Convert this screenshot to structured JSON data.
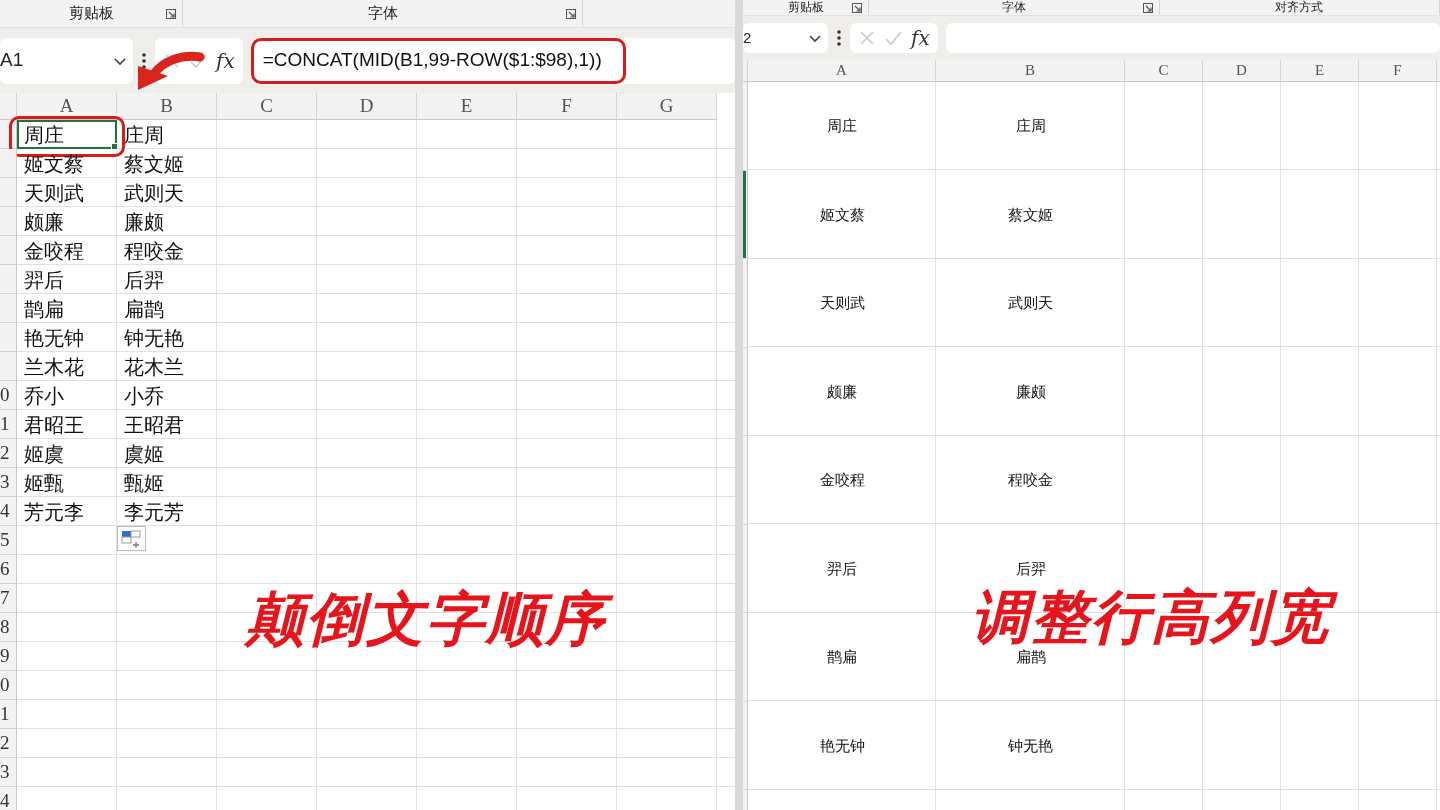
{
  "panels": [
    {
      "ribbon_groups": [
        {
          "label": "剪贴板",
          "launcher": true
        },
        {
          "label": "字体",
          "launcher": true
        }
      ],
      "name_box": "A1",
      "function_label": "fx",
      "formula": {
        "text": "=CONCAT(MID(B1,99-ROW($1:$98),1))",
        "highlighted": true
      },
      "arrow": true,
      "columns": [
        "A",
        "B",
        "C",
        "D",
        "E",
        "F",
        "G"
      ],
      "rows": [
        {
          "cells": [
            {
              "text": "周庄",
              "selected": true,
              "highlighted": true
            },
            {
              "text": "庄周",
              "selected": false,
              "highlighted": false
            }
          ]
        },
        {
          "cells": [
            {
              "text": "姬文蔡",
              "selected": false,
              "highlighted": false
            },
            {
              "text": "蔡文姬",
              "selected": false,
              "highlighted": false
            }
          ]
        },
        {
          "cells": [
            {
              "text": "天则武",
              "selected": false,
              "highlighted": false
            },
            {
              "text": "武则天",
              "selected": false,
              "highlighted": false
            }
          ]
        },
        {
          "cells": [
            {
              "text": "颇廉",
              "selected": false,
              "highlighted": false
            },
            {
              "text": "廉颇",
              "selected": false,
              "highlighted": false
            }
          ]
        },
        {
          "cells": [
            {
              "text": "金咬程",
              "selected": false,
              "highlighted": false
            },
            {
              "text": "程咬金",
              "selected": false,
              "highlighted": false
            }
          ]
        },
        {
          "cells": [
            {
              "text": "羿后",
              "selected": false,
              "highlighted": false
            },
            {
              "text": "后羿",
              "selected": false,
              "highlighted": false
            }
          ]
        },
        {
          "cells": [
            {
              "text": "鹊扁",
              "selected": false,
              "highlighted": false
            },
            {
              "text": "扁鹊",
              "selected": false,
              "highlighted": false
            }
          ]
        },
        {
          "cells": [
            {
              "text": "艳无钟",
              "selected": false,
              "highlighted": false
            },
            {
              "text": "钟无艳",
              "selected": false,
              "highlighted": false
            }
          ]
        },
        {
          "cells": [
            {
              "text": "兰木花",
              "selected": false,
              "highlighted": false
            },
            {
              "text": "花木兰",
              "selected": false,
              "highlighted": false
            }
          ]
        },
        {
          "header": "0",
          "cells": [
            {
              "text": "乔小",
              "selected": false,
              "highlighted": false
            },
            {
              "text": "小乔",
              "selected": false,
              "highlighted": false
            }
          ]
        },
        {
          "header": "1",
          "cells": [
            {
              "text": "君昭王",
              "selected": false,
              "highlighted": false
            },
            {
              "text": "王昭君",
              "selected": false,
              "highlighted": false
            }
          ]
        },
        {
          "header": "2",
          "cells": [
            {
              "text": "姬虞",
              "selected": false,
              "highlighted": false
            },
            {
              "text": "虞姬",
              "selected": false,
              "highlighted": false
            }
          ]
        },
        {
          "header": "3",
          "cells": [
            {
              "text": "姬甄",
              "selected": false,
              "highlighted": false
            },
            {
              "text": "甄姬",
              "selected": false,
              "highlighted": false
            }
          ]
        },
        {
          "header": "4",
          "cells": [
            {
              "text": "芳元李",
              "selected": false,
              "highlighted": false
            },
            {
              "text": "李元芳",
              "selected": false,
              "highlighted": false
            }
          ]
        },
        {
          "header": "5"
        },
        {
          "header": "6"
        },
        {
          "header": "7"
        },
        {
          "header": "8"
        },
        {
          "header": "9"
        },
        {
          "header": "0"
        },
        {
          "header": "1"
        },
        {
          "header": "2"
        },
        {
          "header": "3"
        },
        {
          "header": "4"
        }
      ],
      "caption": "颠倒文字顺序"
    },
    {
      "ribbon_groups": [
        {
          "label": "剪贴板",
          "launcher": true
        },
        {
          "label": "字体",
          "launcher": true
        },
        {
          "label": "对齐方式",
          "launcher": false
        }
      ],
      "name_box": "2",
      "function_label": "fx",
      "arrow": false,
      "columns": [
        "A",
        "B",
        "C",
        "D",
        "E",
        "F"
      ],
      "rows": [
        {
          "selected": false,
          "cells": [
            {
              "text": "周庄"
            },
            {
              "text": "庄周"
            }
          ]
        },
        {
          "selected": true,
          "cells": [
            {
              "text": "姬文蔡"
            },
            {
              "text": "蔡文姬"
            }
          ]
        },
        {
          "selected": false,
          "cells": [
            {
              "text": "天则武"
            },
            {
              "text": "武则天"
            }
          ]
        },
        {
          "selected": false,
          "cells": [
            {
              "text": "颇廉"
            },
            {
              "text": "廉颇"
            }
          ]
        },
        {
          "selected": false,
          "cells": [
            {
              "text": "金咬程"
            },
            {
              "text": "程咬金"
            }
          ]
        },
        {
          "selected": false,
          "cells": [
            {
              "text": "羿后"
            },
            {
              "text": "后羿"
            }
          ]
        },
        {
          "selected": false,
          "cells": [
            {
              "text": "鹊扁"
            },
            {
              "text": "扁鹊"
            }
          ]
        },
        {
          "selected": false,
          "cells": [
            {
              "text": "艳无钟"
            },
            {
              "text": "钟无艳"
            }
          ]
        },
        {
          "selected": false
        }
      ],
      "caption": "调整行高列宽"
    }
  ]
}
